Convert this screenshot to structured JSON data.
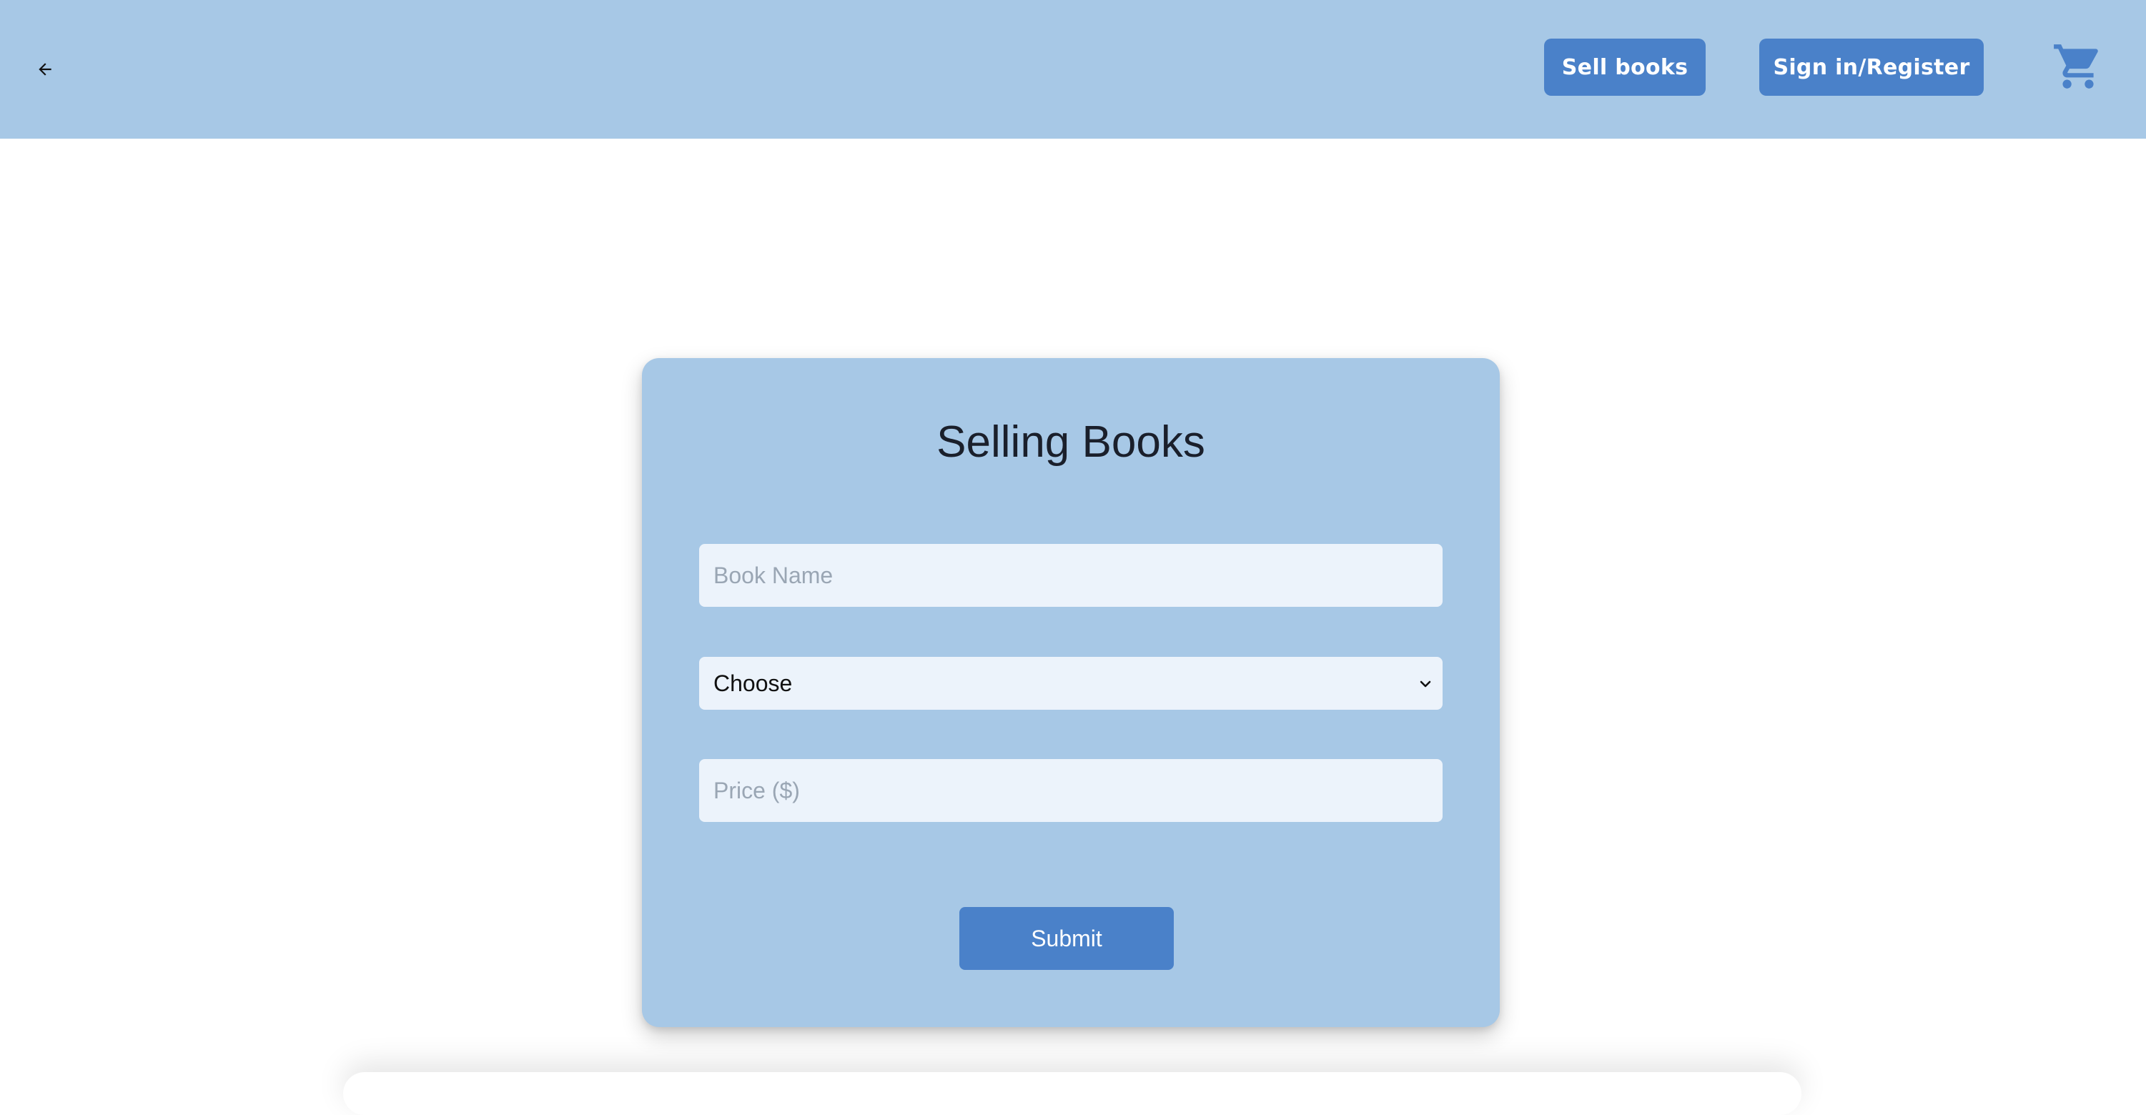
{
  "header": {
    "back_icon": "arrow-left-icon",
    "sell_label": "Sell books",
    "signin_label": "Sign in/Register",
    "cart_icon": "shopping-cart-icon",
    "bar_color": "#a7c8e6",
    "button_color": "#4a81c9"
  },
  "form": {
    "title": "Selling Books",
    "book_name_placeholder": "Book Name",
    "book_name_value": "",
    "select_value": "Choose",
    "price_placeholder": "Price ($)",
    "price_value": "",
    "submit_label": "Submit",
    "card_color": "#a7c8e6",
    "field_color": "#ecf3fb"
  }
}
